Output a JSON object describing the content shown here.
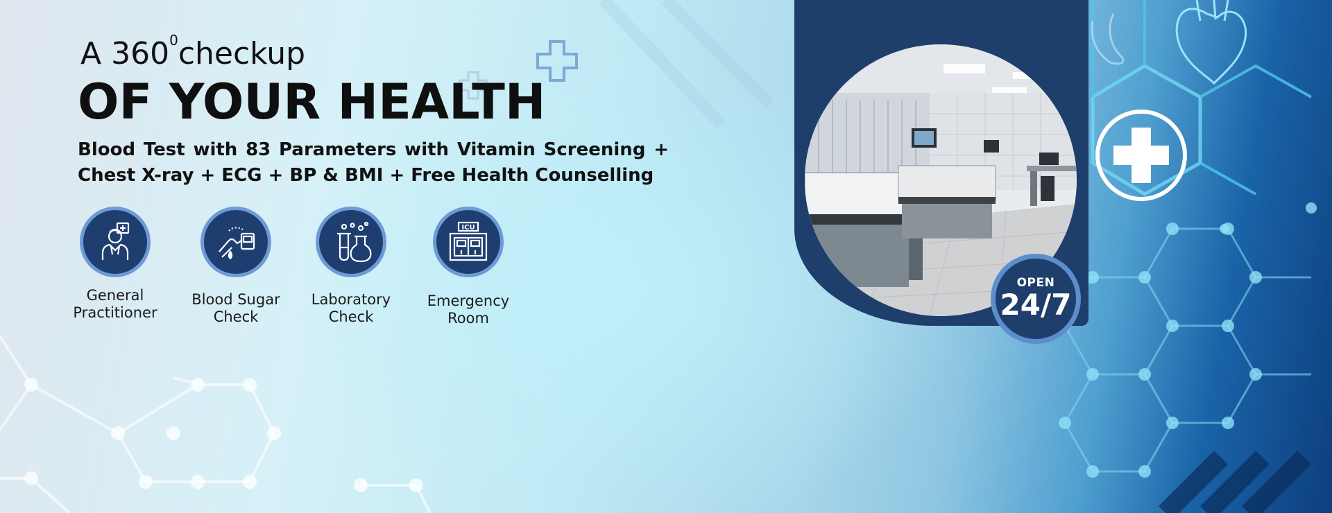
{
  "banner": {
    "title_prefix": "A 360",
    "title_degree": "0",
    "title_suffix": "checkup",
    "title_main": "OF YOUR HEALTH",
    "subtitle_line1": "Blood Test with 83 Parameters with Vitamin Screening +",
    "subtitle_line2": "Chest X-ray + ECG + BP & BMI + Free Health Counselling"
  },
  "features": [
    {
      "line1": "General",
      "line2": "Practitioner",
      "icon": "doctor-icon"
    },
    {
      "line1": "Blood Sugar",
      "line2": "Check",
      "icon": "glucose-meter-icon"
    },
    {
      "line1": "Laboratory",
      "line2": "Check",
      "icon": "lab-flask-icon"
    },
    {
      "line1": "Emergency",
      "line2": "Room",
      "icon": "icu-icon"
    }
  ],
  "photo_panel": {
    "icu_sign": "ICU"
  },
  "badge": {
    "open_label": "OPEN",
    "hours": "24/7"
  },
  "colors": {
    "navy": "#1e3e6c",
    "ring": "#5c8ecb",
    "accent_blue": "#0d3f7c"
  }
}
